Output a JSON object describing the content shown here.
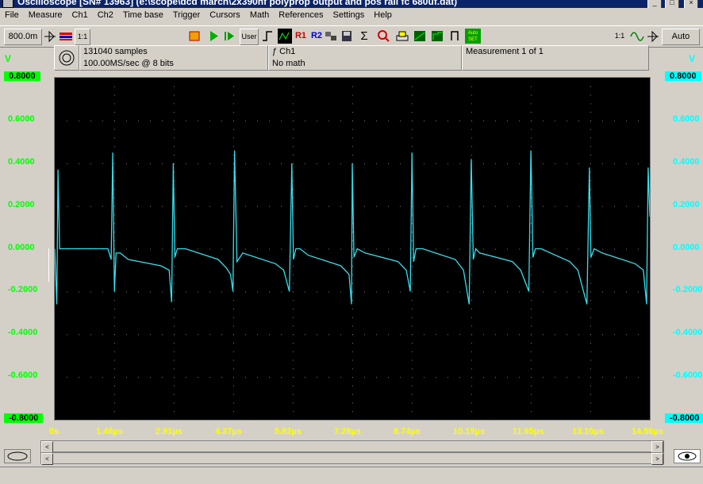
{
  "window": {
    "title": "Oscilloscope  [SN# 13963]  (e:\\scope\\dcd march\\2x390nf polyprop output and pos rail fc 680uf.dat)"
  },
  "menu": [
    "File",
    "Measure",
    "Ch1",
    "Ch2",
    "Time base",
    "Trigger",
    "Cursors",
    "Math",
    "References",
    "Settings",
    "Help"
  ],
  "toolbar": {
    "timebase": "800.0m",
    "scale_1": "1:1",
    "user_label": "User",
    "r1_label": "R1",
    "r2_label": "R2",
    "autoset_label": "Auto SET",
    "scale_2": "1:1",
    "auto_label": "Auto"
  },
  "info": {
    "samples": "131040 samples",
    "rate": "100.00MS/sec @ 8 bits",
    "channel": "ƒ Ch1",
    "math": "No math",
    "measurement": "Measurement 1 of 1"
  },
  "left_axis": {
    "unit": "V",
    "labels": [
      "0.8000",
      "0.6000",
      "0.4000",
      "0.2000",
      "0.0000",
      "-0.2000",
      "-0.4000",
      "-0.6000",
      "-0.8000"
    ]
  },
  "right_axis": {
    "unit": "V",
    "labels": [
      "0.8000",
      "0.6000",
      "0.4000",
      "0.2000",
      "0.0000",
      "-0.2000",
      "-0.4000",
      "-0.6000",
      "-0.8000"
    ]
  },
  "x_axis": {
    "labels": [
      "0s",
      "1.46µs",
      "2.91µs",
      "4.37µs",
      "5.82µs",
      "7.28µs",
      "8.74µs",
      "10.19µs",
      "11.65µs",
      "13.10µs",
      "14.56µs"
    ]
  },
  "colors": {
    "trace": "#33e0ee",
    "grid": "#7a7a7a",
    "left_axis": "#00ff00",
    "right_axis": "#00ffff",
    "x_axis": "#ffff00",
    "plot_bg": "#000000"
  },
  "chart_data": {
    "type": "line",
    "xlabel": "",
    "ylabel": "V",
    "xlim": [
      0,
      14.56
    ],
    "ylim": [
      -0.8,
      0.8
    ],
    "grid": true,
    "series": [
      {
        "x": [
          0.0,
          0.05,
          0.08,
          0.12,
          0.3,
          1.3,
          1.38,
          1.42,
          1.46,
          1.5,
          1.6,
          1.8,
          2.6,
          2.8,
          2.86,
          2.9,
          2.94,
          3.0,
          3.2,
          4.0,
          4.2,
          4.3,
          4.36,
          4.4,
          4.46,
          4.6,
          5.4,
          5.6,
          5.74,
          5.8,
          5.84,
          5.9,
          6.0,
          6.2,
          7.0,
          7.2,
          7.26,
          7.28,
          7.32,
          7.4,
          7.6,
          8.4,
          8.6,
          8.7,
          8.74,
          8.78,
          8.84,
          9.0,
          9.8,
          10.0,
          10.14,
          10.19,
          10.24,
          10.3,
          10.4,
          11.2,
          11.4,
          11.6,
          11.65,
          11.7,
          11.76,
          11.9,
          12.6,
          12.8,
          13.02,
          13.08,
          13.12,
          13.2,
          13.4,
          14.2,
          14.4,
          14.48,
          14.52,
          14.56
        ],
        "values": [
          0.0,
          -0.26,
          0.37,
          0.0,
          0.0,
          0.0,
          -0.05,
          0.45,
          -0.2,
          -0.02,
          -0.02,
          -0.05,
          -0.08,
          -0.1,
          -0.25,
          0.4,
          -0.04,
          0.0,
          0.0,
          -0.05,
          -0.09,
          -0.12,
          -0.2,
          0.46,
          -0.06,
          -0.02,
          -0.07,
          -0.1,
          -0.2,
          0.4,
          -0.05,
          0.0,
          0.0,
          -0.03,
          -0.08,
          -0.12,
          -0.26,
          0.4,
          -0.04,
          0.0,
          -0.02,
          -0.06,
          -0.1,
          -0.2,
          0.45,
          -0.06,
          0.0,
          0.0,
          -0.05,
          -0.1,
          -0.26,
          0.42,
          -0.05,
          0.0,
          -0.02,
          -0.06,
          -0.1,
          -0.2,
          0.46,
          -0.04,
          0.0,
          0.0,
          -0.06,
          -0.1,
          -0.26,
          0.38,
          -0.04,
          0.0,
          -0.02,
          -0.07,
          -0.1,
          -0.26,
          0.38,
          0.15
        ]
      }
    ]
  },
  "bottom": {
    "left_arrow": "<",
    "right_arrow": ">"
  }
}
